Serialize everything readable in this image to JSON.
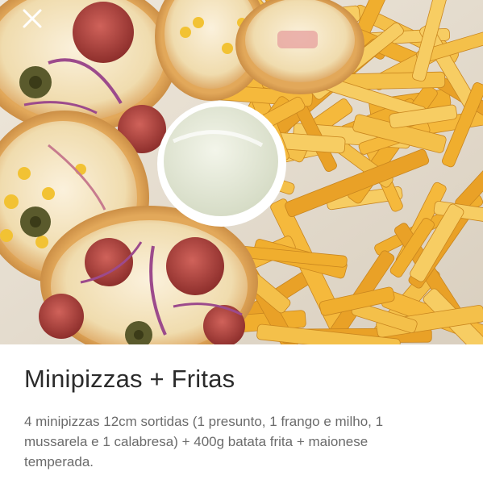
{
  "product": {
    "name": "Minipizzas + Fritas",
    "description": "4 minipizzas 12cm sortidas (1 presunto, 1 frango e milho, 1 mussarela e 1 calabresa)  + 400g batata frita + maionese temperada.",
    "photo_alt": "Minipizzas + Fritas"
  },
  "controls": {
    "close_icon": "close-icon",
    "close_label": "Fechar"
  },
  "colors": {
    "title": "#2b2b2b",
    "description": "#6b6b6b",
    "close_icon": "#ffffff",
    "fries": "#f2b236",
    "cheese": "#f5e6c4",
    "pepperoni": "#b5403a"
  }
}
